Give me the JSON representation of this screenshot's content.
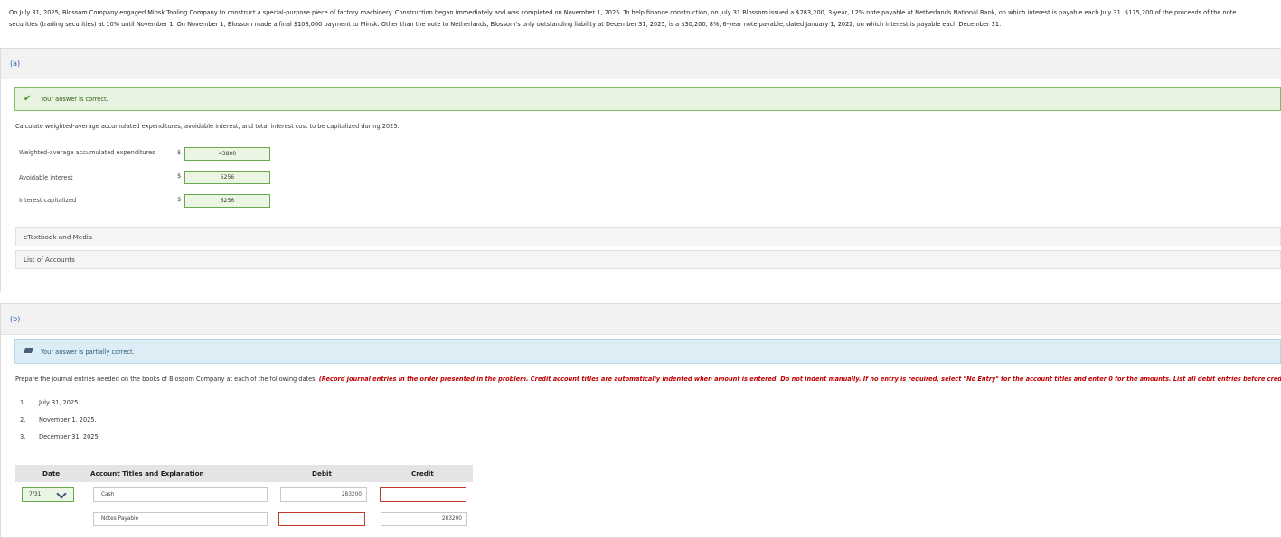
{
  "problem": {
    "line1": "On July 31, 2025, Blossom Company engaged Minsk Tooling Company to construct a special-purpose piece of factory machinery. Construction began immediately and was completed on November 1, 2025. To help finance construction, on July 31 Blossom issued a $283,200, 3-year, 12% note payable at Netherlands National Bank, on which interest is payable each July 31. $175,200 of the proceeds of the note",
    "line2": "securities (trading securities) at 10% until November 1. On November 1, Blossom made a final $108,000 payment to Minsk. Other than the note to Netherlands, Blossom's only outstanding liability at December 31, 2025, is a $30,200, 8%, 6-year note payable, dated January 1, 2022, on which interest is payable each December 31."
  },
  "part_a": {
    "label": "(a)",
    "status": "Your answer is correct.",
    "instruction": "Calculate weighted-average accumulated expenditures, avoidable interest, and total interest cost to be capitalized during 2025.",
    "rows": [
      {
        "label": "Weighted-average accumulated expenditures",
        "currency": "$",
        "value": "43800"
      },
      {
        "label": "Avoidable interest",
        "currency": "$",
        "value": "5256"
      },
      {
        "label": "Interest capitalized",
        "currency": "$",
        "value": "5256"
      }
    ],
    "links": [
      "eTextbook and Media",
      "List of Accounts"
    ]
  },
  "part_b": {
    "label": "(b)",
    "status": "Your answer is partially correct.",
    "instruction": "Prepare the journal entries needed on the books of Blossom Company at each of the following dates.",
    "instruction_red": "(Record journal entries in the order presented in the problem. Credit account titles are automatically indented when amount is entered. Do not indent manually. If no entry is required, select \"No Entry\" for the account titles and enter 0 for the amounts. List all debit entries before credit entries.)",
    "dates": [
      {
        "num": "1.",
        "text": "July 31, 2025."
      },
      {
        "num": "2.",
        "text": "November 1, 2025."
      },
      {
        "num": "3.",
        "text": "December 31, 2025."
      }
    ],
    "table": {
      "headers": {
        "date": "Date",
        "account": "Account Titles and Explanation",
        "debit": "Debit",
        "credit": "Credit"
      },
      "date_value": "7/31",
      "entries": [
        {
          "account": "Cash",
          "debit": "283200",
          "credit": ""
        },
        {
          "account": "Notes Payable",
          "debit": "",
          "credit": "283200"
        }
      ]
    }
  },
  "colors": {
    "correct_bg": "#e8f3e1",
    "partial_bg": "#dcedf6",
    "error_border": "#c0392b",
    "instruction_red": "#c00000"
  }
}
